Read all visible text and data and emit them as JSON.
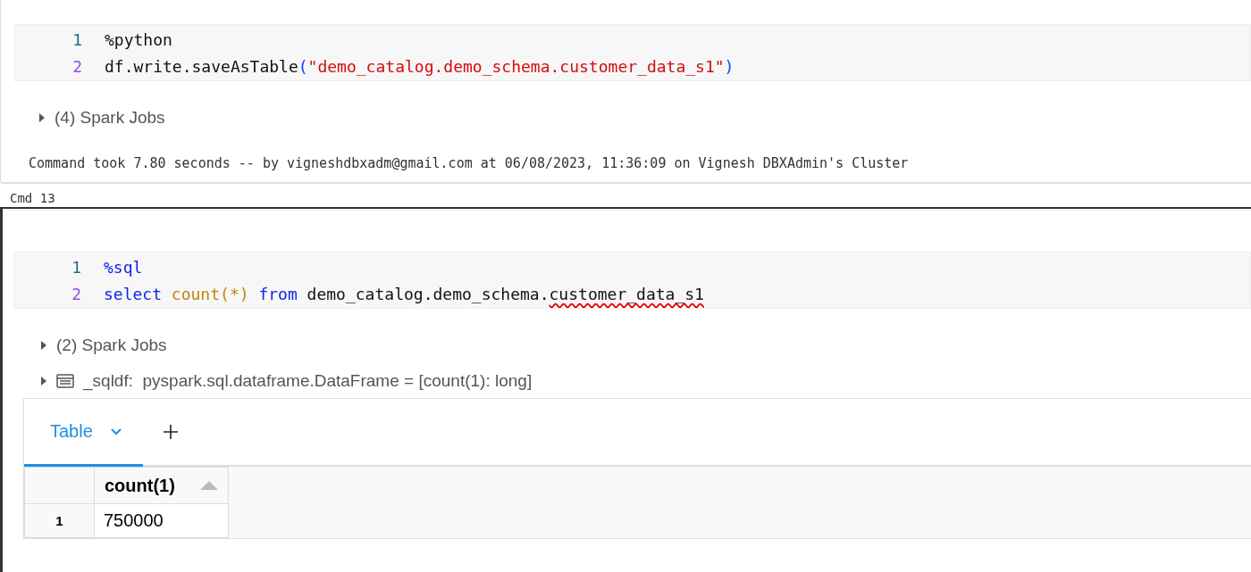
{
  "cells": [
    {
      "code_lines": [
        {
          "number": "1",
          "tokens": [
            {
              "text": "%python",
              "kind": "plain"
            }
          ]
        },
        {
          "number": "2",
          "tokens": [
            {
              "text": "df.write.saveAsTable",
              "kind": "plain"
            },
            {
              "text": "(",
              "kind": "paren"
            },
            {
              "text": "\"demo_catalog.demo_schema.customer_data_s1\"",
              "kind": "string"
            },
            {
              "text": ")",
              "kind": "paren"
            }
          ]
        }
      ],
      "outputs": [
        {
          "kind": "jobs",
          "expanded": false,
          "text": "(4) Spark Jobs"
        }
      ],
      "footer": "Command took 7.80 seconds -- by vigneshdbxadm@gmail.com at 06/08/2023, 11:36:09 on Vignesh DBXAdmin's Cluster"
    },
    {
      "label": "Cmd 13",
      "code_lines": [
        {
          "number": "1",
          "tokens": [
            {
              "text": "%sql",
              "kind": "keyword"
            }
          ]
        },
        {
          "number": "2",
          "tokens": [
            {
              "text": "select ",
              "kind": "keyword"
            },
            {
              "text": "count(*)",
              "kind": "function"
            },
            {
              "text": " from ",
              "kind": "keyword"
            },
            {
              "text": "demo_catalog.demo_schema.",
              "kind": "plain"
            },
            {
              "text": "customer_data_s1",
              "kind": "error"
            }
          ]
        }
      ],
      "outputs": [
        {
          "kind": "jobs",
          "expanded": false,
          "text": "(2) Spark Jobs"
        },
        {
          "kind": "schema",
          "expanded": false,
          "text": "_sqldf:  pyspark.sql.dataframe.DataFrame = [count(1): long]"
        }
      ],
      "result": {
        "tabs": [
          {
            "label": "Table",
            "selected": true
          }
        ],
        "table": {
          "columns": [
            "count(1)"
          ],
          "rows": [
            {
              "index": "1",
              "cells": [
                "750000"
              ]
            }
          ]
        }
      }
    }
  ]
}
